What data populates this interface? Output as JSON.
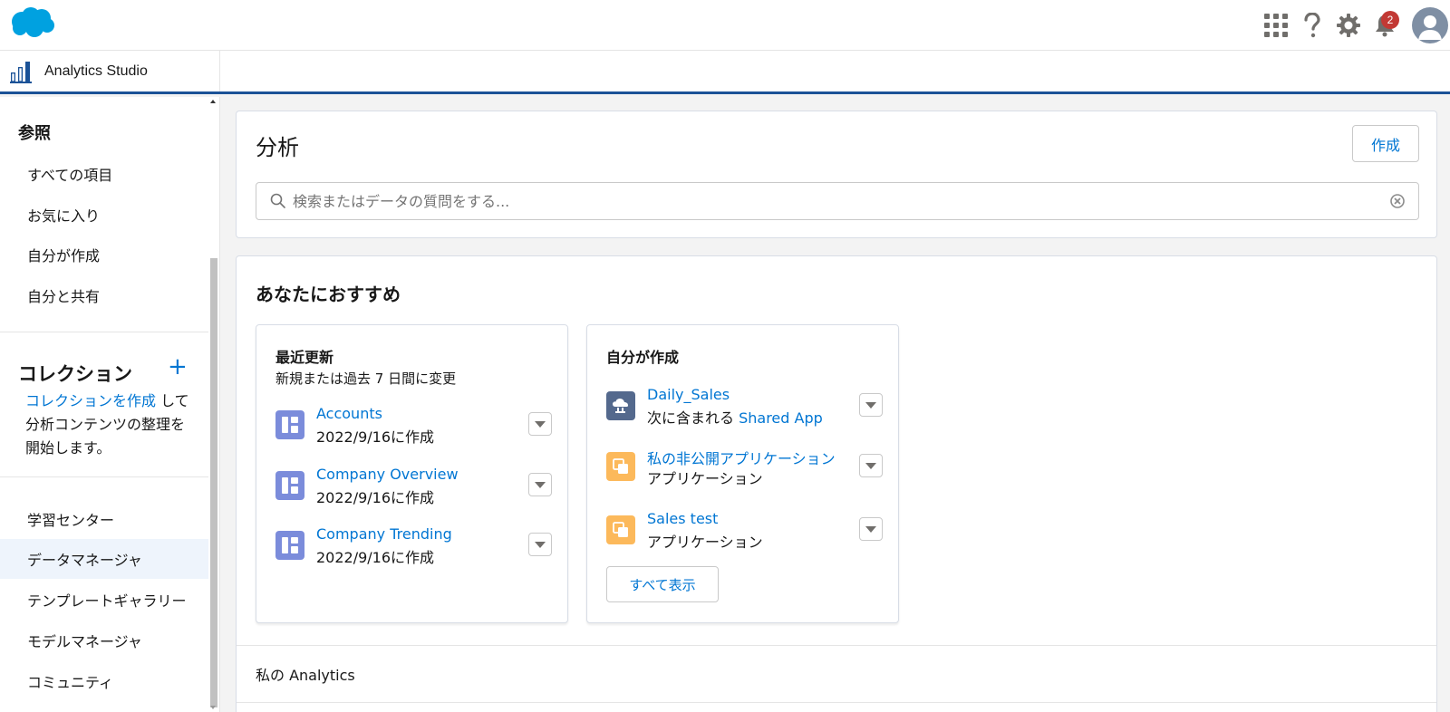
{
  "header": {
    "app_launcher_icon": "app-launcher-icon",
    "help_icon": "question-icon",
    "setup_icon": "gear-icon",
    "notifications_icon": "bell-icon",
    "notification_count": "2",
    "avatar_icon": "user-avatar-icon"
  },
  "app_bar": {
    "title": "Analytics Studio",
    "icon": "bar-chart-icon"
  },
  "sidebar": {
    "browse_heading": "参照",
    "browse_items": [
      {
        "label": "すべての項目"
      },
      {
        "label": "お気に入り"
      },
      {
        "label": "自分が作成"
      },
      {
        "label": "自分と共有"
      }
    ],
    "collections_heading": "コレクション",
    "collections_add": "+",
    "collections_link": "コレクションを作成",
    "collections_text": " して分析コンテンツの整理を開始します。",
    "bottom_items": [
      {
        "label": "学習センター"
      },
      {
        "label": "データマネージャ",
        "active": true
      },
      {
        "label": "テンプレートギャラリー"
      },
      {
        "label": "モデルマネージャ"
      },
      {
        "label": "コミュニティ"
      }
    ]
  },
  "main": {
    "title": "分析",
    "create_button": "作成",
    "search_placeholder": "検索またはデータの質問をする..."
  },
  "recommendations": {
    "title": "あなたにおすすめ",
    "recent": {
      "title": "最近更新",
      "subtitle": "新規または過去 7 日間に変更",
      "items": [
        {
          "name": "Accounts",
          "sub": "2022/9/16に作成"
        },
        {
          "name": "Company Overview",
          "sub": "2022/9/16に作成"
        },
        {
          "name": "Company Trending",
          "sub": "2022/9/16に作成"
        }
      ]
    },
    "created_by_me": {
      "title": "自分が作成",
      "items": [
        {
          "name": "Daily_Sales",
          "sub_prefix": "次に含まれる ",
          "sub_link": "Shared App"
        },
        {
          "name": "私の非公開アプリケーション",
          "sub": "アプリケーション"
        },
        {
          "name": "Sales test",
          "sub": "アプリケーション"
        }
      ],
      "view_all": "すべて表示"
    },
    "my_analytics": "私の Analytics"
  },
  "colors": {
    "brand_blue": "#0176d3",
    "app_bar_border": "#1b5297",
    "dashboard_icon": "#7b8cdb",
    "dataflow_icon": "#54698d",
    "app_icon": "#fcb95b",
    "badge": "#c23934"
  }
}
